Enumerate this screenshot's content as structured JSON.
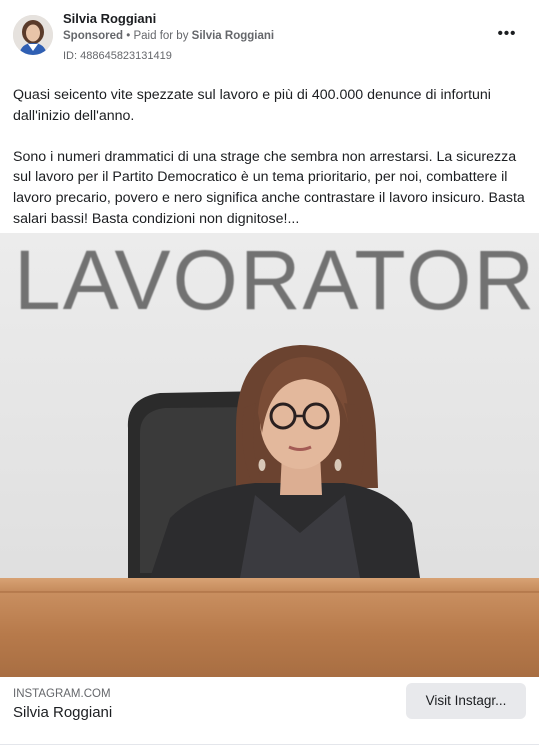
{
  "post": {
    "author": "Silvia Roggiani",
    "sponsored": "Sponsored",
    "separator": " • ",
    "paid_prefix": "Paid for by ",
    "paid_by": "Silvia Roggiani",
    "ad_id": "ID: 488645823131419",
    "more_label": "•••",
    "text_p1": "Quasi seicento vite spezzate sul lavoro e più di 400.000 denunce di infortuni dall'inizio dell'anno.",
    "text_p2": "Sono i numeri drammatici di una strage che sembra non arrestarsi. La sicurezza sul lavoro per il Partito Democratico è un tema prioritario, per noi, combattere il lavoro precario, povero e nero significa anche contrastare il lavoro insicuro. Basta salari bassi! Basta condizioni non dignitose!..."
  },
  "media": {
    "wall_text": "LAVORATOR"
  },
  "link_card": {
    "domain": "INSTAGRAM.COM",
    "title": "Silvia Roggiani",
    "button": "Visit Instagr..."
  }
}
